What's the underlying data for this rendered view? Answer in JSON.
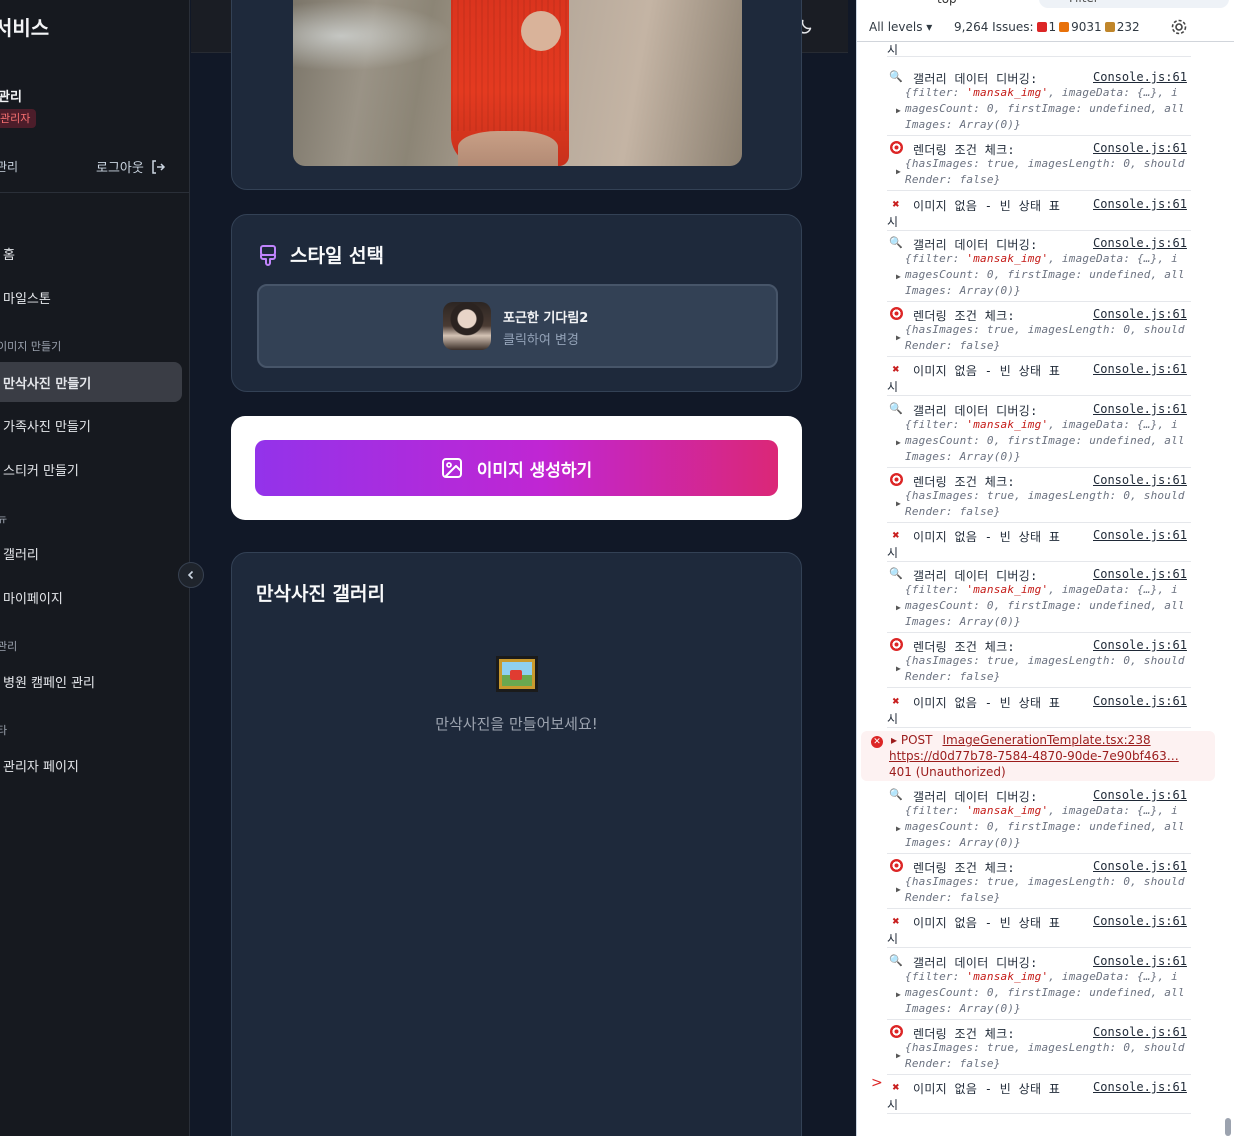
{
  "sidebar": {
    "brand": "서비스",
    "user_name": "관리",
    "role_badge": "관리자",
    "manage_label": "관리",
    "logout_label": "로그아웃",
    "nav": [
      {
        "label": "홈"
      },
      {
        "label": "마일스톤"
      },
      {
        "label": "만삭사진 만들기",
        "active": true
      },
      {
        "label": "가족사진 만들기"
      },
      {
        "label": "스티커 만들기"
      },
      {
        "label": "갤러리"
      },
      {
        "label": "마이페이지"
      },
      {
        "label": "병원 캠페인 관리"
      },
      {
        "label": "관리자 페이지"
      }
    ],
    "sections": [
      "이미지 만들기",
      "뉴",
      "관리",
      "타"
    ]
  },
  "main": {
    "style_section_title": "스타일 선택",
    "style_name": "포근한 기다림2",
    "style_hint": "클릭하여 변경",
    "generate_label": "이미지 생성하기",
    "gallery_title": "만삭사진 갤러리",
    "gallery_empty": "만삭사진을 만들어보세요!"
  },
  "devtools": {
    "context": "top",
    "filter_placeholder": "Filter",
    "levels": "All levels",
    "issues_label": "9,264 Issues:",
    "issues_errors": "1",
    "issues_warnings": "9031",
    "issues_info": "232",
    "console_source": "Console.js:61",
    "msg_gallery": "갤러리 데이터 디버깅:",
    "msg_gallery_obj1_pre": "{filter: ",
    "msg_gallery_obj1_val": "'mansak_img'",
    "msg_gallery_obj1_post": ", imageData: {…}, i",
    "msg_gallery_obj2": "magesCount: 0, firstImage: undefined, all",
    "msg_gallery_obj3": "Images: Array(0)}",
    "msg_render": "렌더링 조건 체크:",
    "msg_render_obj1": "{hasImages: true, imagesLength: 0, should",
    "msg_render_obj2": "Render: false}",
    "msg_empty": "이미지 없음 - 빈 상태 표",
    "msg_empty_wrap": "시",
    "error_method": "POST",
    "error_source": "ImageGenerationTemplate.tsx:238",
    "error_url": "https://d0d77b78-7584-4870-90de-7e90bf463…",
    "error_status": "401 (Unauthorized)",
    "prompt": ">"
  }
}
